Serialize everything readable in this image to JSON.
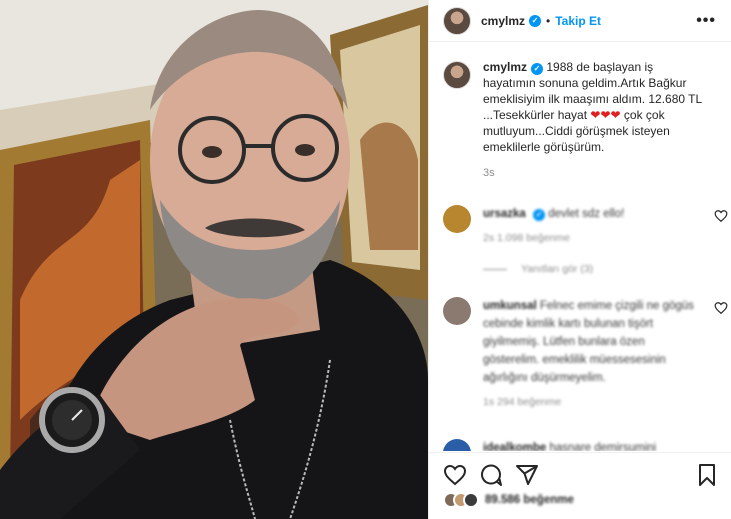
{
  "header": {
    "username": "cmylmz",
    "separator": "•",
    "follow_label": "Takip Et",
    "more_label": "•••"
  },
  "caption": {
    "username": "cmylmz",
    "text": "1988 de başlayan iş hayatımın sonuna geldim.Artık Bağkur emeklisiyim ilk maaşımı aldım. 12.680 TL ...Tesekkürler hayat",
    "hearts": "❤❤❤",
    "text_after": "çok çok mutluyum...Ciddi görüşmek isteyen emeklilerle görüşürüm.",
    "time": "3s"
  },
  "comments": [
    {
      "username": "ursazka",
      "text": "devlet sdz ello!",
      "meta": "2s   1.098 beğenme",
      "avatar_color": "#b8862e"
    },
    {
      "username": "umkunsal",
      "text": "Felnec emime çizgili ne gögüs cebinde kimlik kartı bulunan tişört giyilmemiş. Lütfen bunlara özen gösterelim. emeklilik müessesesinin ağırlığını düşürmeyelim.",
      "meta": "1s   294 beğenme",
      "avatar_color": "#8a7a70"
    },
    {
      "username": "idealkombe",
      "text": "hasnare demirsumini",
      "meta": "",
      "avatar_color": "#2a5fa8"
    }
  ],
  "replies_label": "Yanıtları gör (3)",
  "likes": {
    "text": "89.586 beğenme"
  },
  "icons": [
    "heart-icon",
    "comment-icon",
    "share-icon",
    "bookmark-icon",
    "verified-icon",
    "more-icon"
  ],
  "colors": {
    "accent": "#0095f6",
    "heart": "#e02020"
  }
}
